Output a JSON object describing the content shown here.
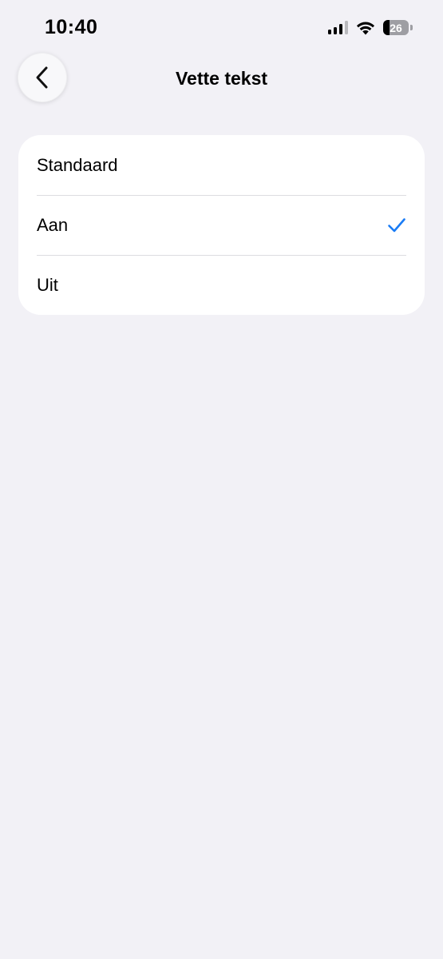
{
  "status_bar": {
    "time": "10:40",
    "battery_level": "26",
    "icons": [
      "cellular-signal-icon",
      "wifi-icon",
      "battery-icon"
    ]
  },
  "nav": {
    "title": "Vette tekst",
    "back_icon": "chevron-left-icon"
  },
  "options": [
    {
      "label": "Standaard",
      "selected": false
    },
    {
      "label": "Aan",
      "selected": true
    },
    {
      "label": "Uit",
      "selected": false
    }
  ],
  "colors": {
    "background": "#f2f1f6",
    "card": "#ffffff",
    "accent": "#1a7cf5",
    "separator": "#dcdce0"
  }
}
